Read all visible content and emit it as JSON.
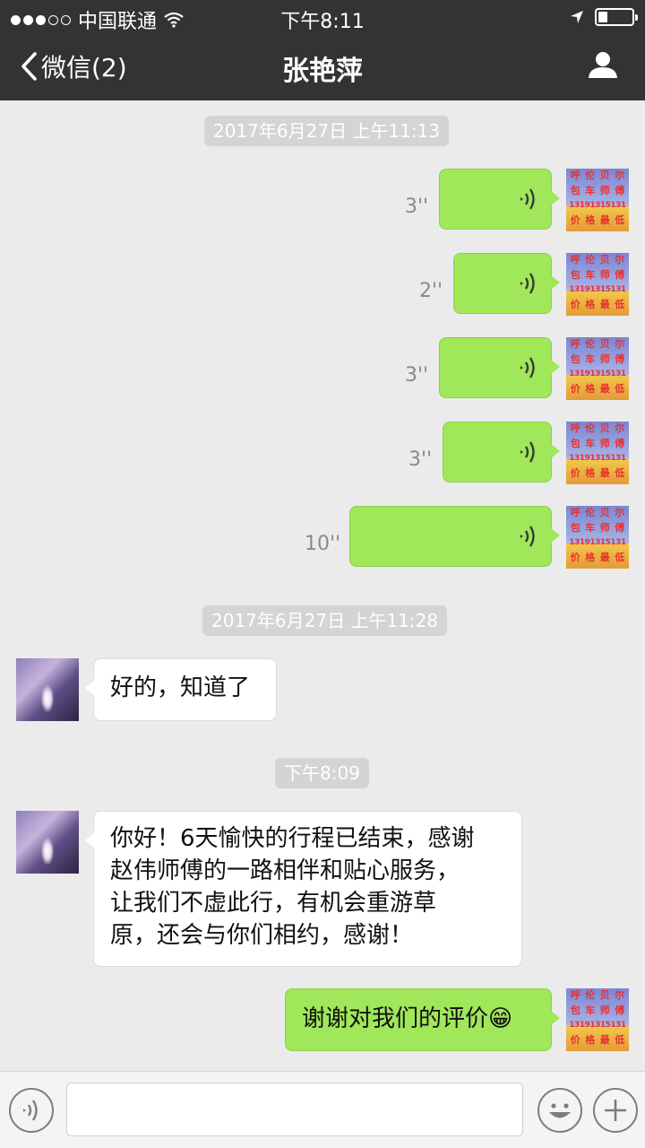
{
  "status": {
    "carrier": "中国联通",
    "time": "下午8:11"
  },
  "nav": {
    "back_label": "微信(2)",
    "title": "张艳萍"
  },
  "timestamps": [
    "2017年6月27日 上午11:13",
    "2017年6月27日 上午11:28",
    "下午8:09"
  ],
  "voice_messages": [
    {
      "duration": "3''"
    },
    {
      "duration": "2''"
    },
    {
      "duration": "3''"
    },
    {
      "duration": "3''"
    },
    {
      "duration": "10''"
    }
  ],
  "received_messages": [
    {
      "text": "好的，知道了"
    },
    {
      "lines": [
        "你好！6天愉快的行程已结束，感谢",
        "赵伟师傅的一路相伴和贴心服务，",
        "让我们不虚此行，有机会重游草",
        "原，还会与你们相约，感谢！"
      ]
    }
  ],
  "sent_text": {
    "text": "谢谢对我们的评价",
    "emoji": "😁"
  },
  "my_avatar": {
    "chars": [
      "呼",
      "伦",
      "贝",
      "尔",
      "包",
      "车",
      "师",
      "傅",
      "价",
      "格",
      "最",
      "低"
    ],
    "phone": "13191315131"
  },
  "colors": {
    "topbar": "#333333",
    "background": "#ebebeb",
    "sent_bubble": "#a0e75a",
    "received_bubble": "#ffffff"
  }
}
